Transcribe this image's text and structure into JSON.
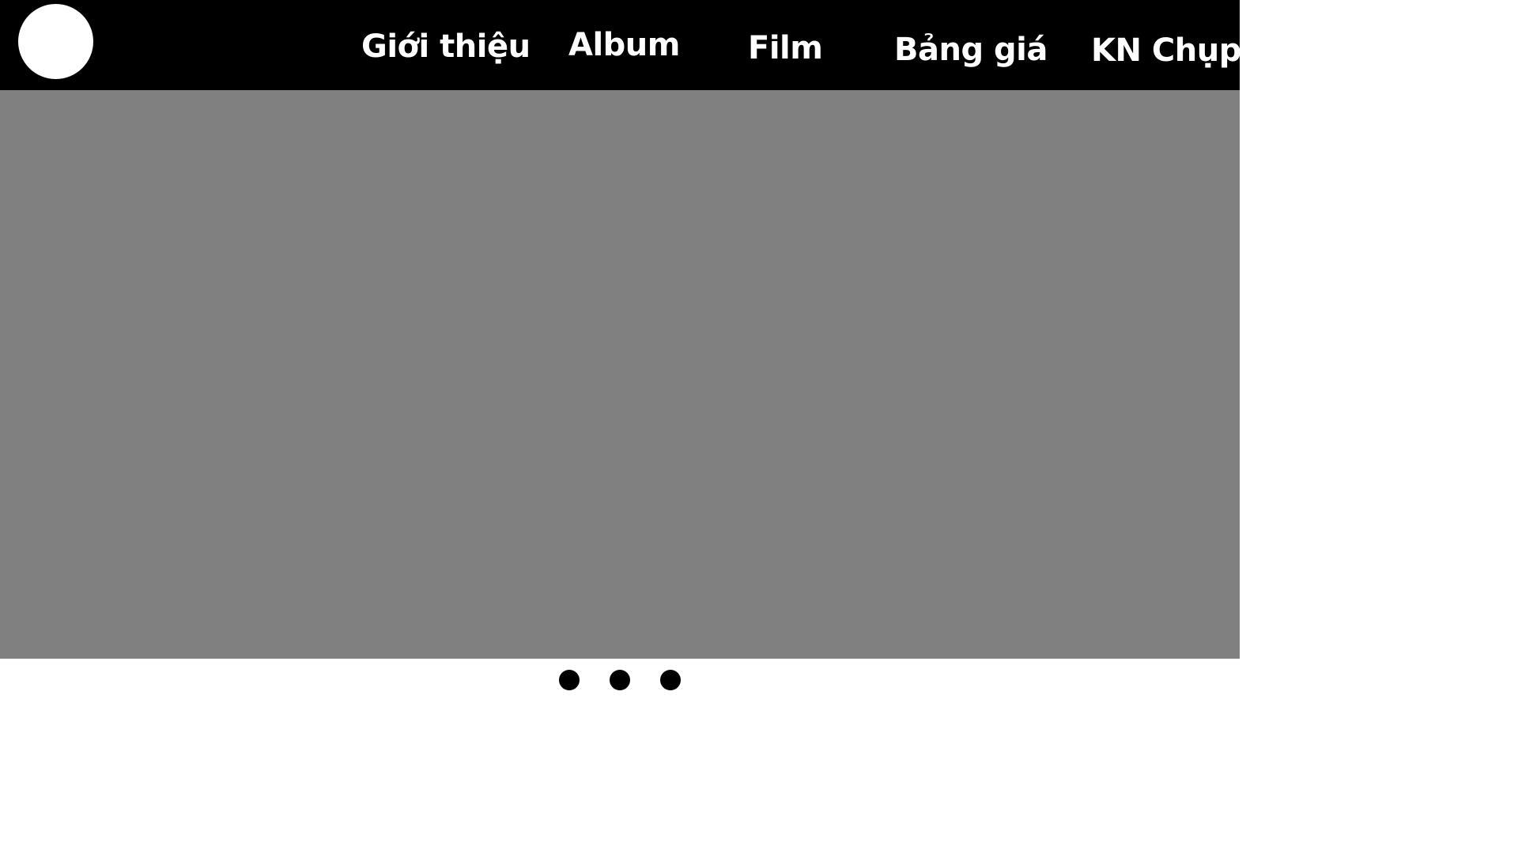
{
  "header": {
    "nav": [
      {
        "label": "Giới thiệu"
      },
      {
        "label": "Album"
      },
      {
        "label": "Film"
      },
      {
        "label": "Bảng giá"
      },
      {
        "label": "KN Chụp"
      }
    ]
  },
  "carousel": {
    "slide_count": 3
  },
  "colors": {
    "header_bg": "#000000",
    "nav_text": "#ffffff",
    "hero_bg": "#808080",
    "dot": "#000000"
  }
}
